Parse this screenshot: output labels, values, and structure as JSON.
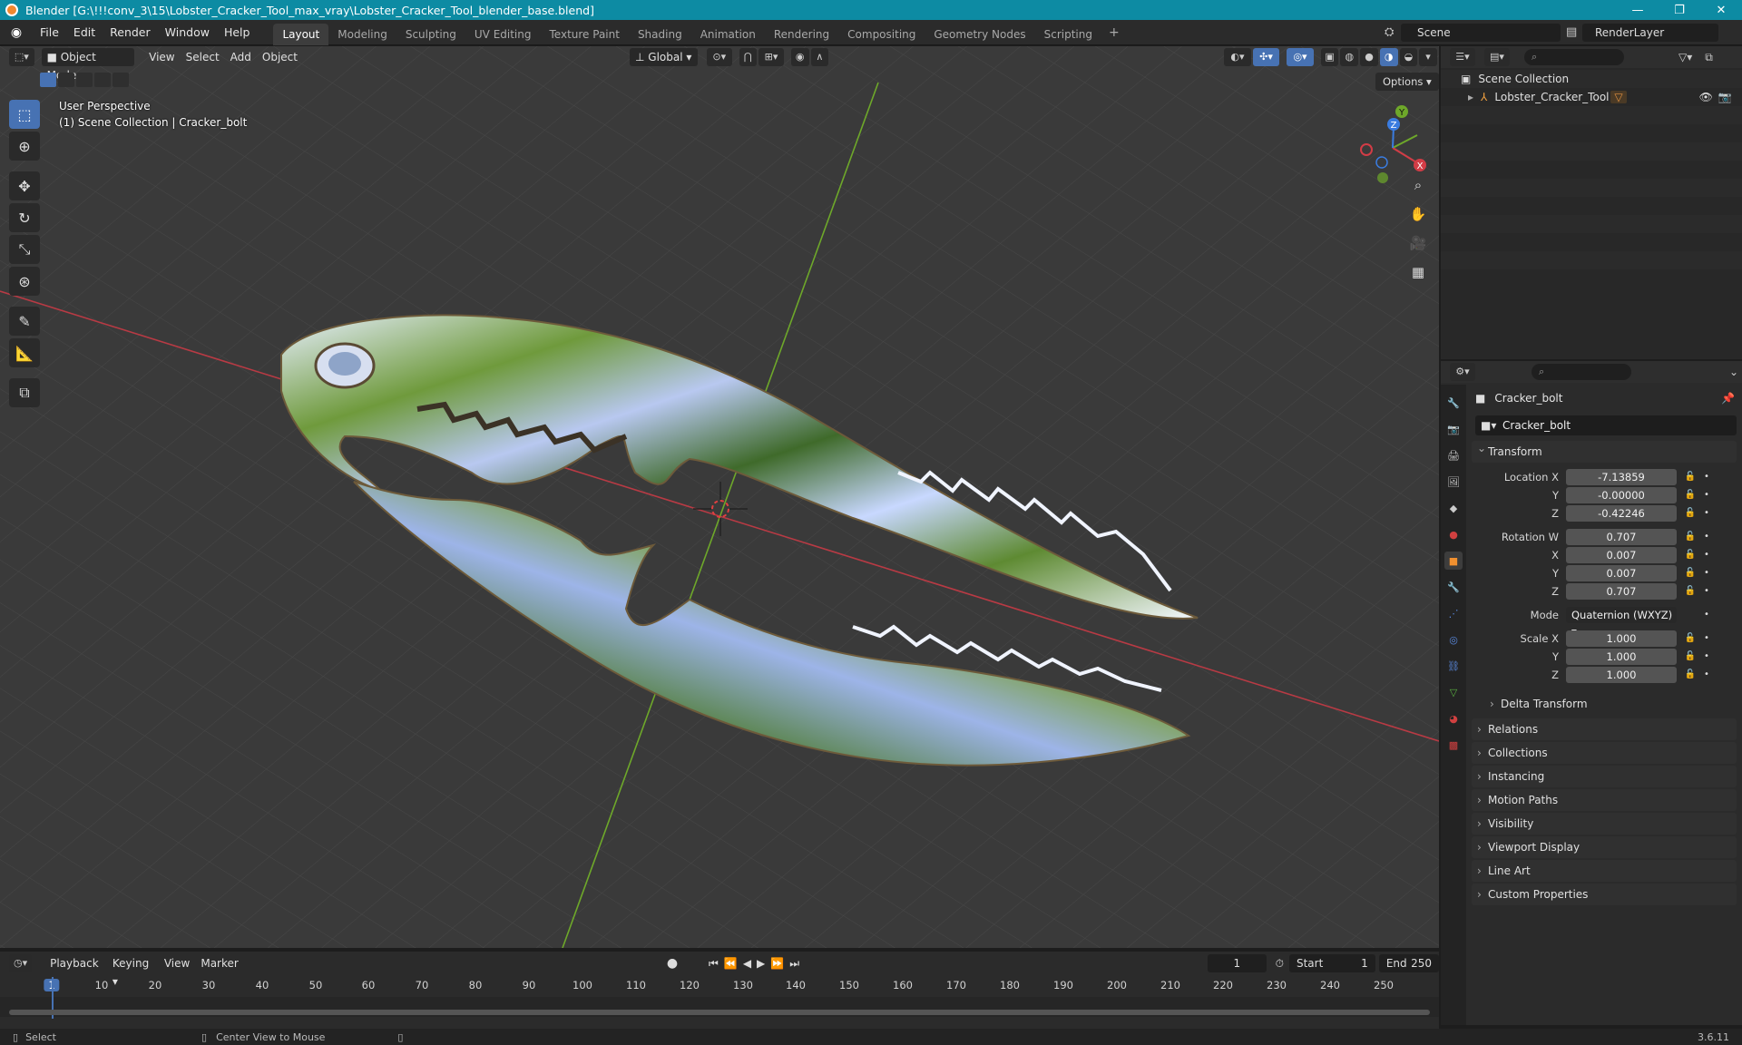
{
  "window": {
    "title": "Blender [G:\\!!!conv_3\\15\\Lobster_Cracker_Tool_max_vray\\Lobster_Cracker_Tool_blender_base.blend]"
  },
  "menus": [
    "File",
    "Edit",
    "Render",
    "Window",
    "Help"
  ],
  "workspaces": [
    "Layout",
    "Modeling",
    "Sculpting",
    "UV Editing",
    "Texture Paint",
    "Shading",
    "Animation",
    "Rendering",
    "Compositing",
    "Geometry Nodes",
    "Scripting"
  ],
  "active_workspace": "Layout",
  "scene": {
    "name": "Scene",
    "view_layer": "RenderLayer"
  },
  "viewport": {
    "mode": "Object Mode",
    "menus": [
      "View",
      "Select",
      "Add",
      "Object"
    ],
    "orientation": "Global",
    "options": "Options",
    "info_line1": "User Perspective",
    "info_line2": "(1) Scene Collection | Cracker_bolt",
    "gizmo": {
      "x": "X",
      "y": "Y",
      "z": "Z"
    }
  },
  "outliner": {
    "root": "Scene Collection",
    "items": [
      {
        "label": "Lobster_Cracker_Tool"
      }
    ]
  },
  "properties": {
    "object_name": "Cracker_bolt",
    "datablock": "Cracker_bolt",
    "transform_label": "Transform",
    "location": {
      "label": "Location X",
      "x": "-7.13859",
      "y": "-0.00000",
      "z": "-0.42246"
    },
    "rotation": {
      "label": "Rotation W",
      "w": "0.707",
      "x": "0.007",
      "y": "0.007",
      "z": "0.707"
    },
    "mode": {
      "label": "Mode",
      "value": "Quaternion (WXYZ)"
    },
    "scale": {
      "label": "Scale X",
      "x": "1.000",
      "y": "1.000",
      "z": "1.000"
    },
    "axis": {
      "y": "Y",
      "x": "X",
      "z": "Z"
    },
    "delta": "Delta Transform",
    "panels": [
      "Relations",
      "Collections",
      "Instancing",
      "Motion Paths",
      "Visibility",
      "Viewport Display",
      "Line Art",
      "Custom Properties"
    ]
  },
  "timeline": {
    "menus": [
      "Playback",
      "Keying",
      "View",
      "Marker"
    ],
    "current_frame": "1",
    "start_label": "Start",
    "start": "1",
    "end_label": "End",
    "end": "250",
    "ticks": [
      "1",
      "10",
      "20",
      "30",
      "40",
      "50",
      "60",
      "70",
      "80",
      "90",
      "100",
      "110",
      "120",
      "130",
      "140",
      "150",
      "160",
      "170",
      "180",
      "190",
      "200",
      "210",
      "220",
      "230",
      "240",
      "250"
    ]
  },
  "status": {
    "left": "Select",
    "middle": "Center View to Mouse",
    "version": "3.6.11"
  },
  "colors": {
    "accent": "#4772b3",
    "titlebar": "#0d8ba3",
    "x_axis": "#d23c46",
    "y_axis": "#6ea82a",
    "z_axis": "#3a7ce0"
  }
}
